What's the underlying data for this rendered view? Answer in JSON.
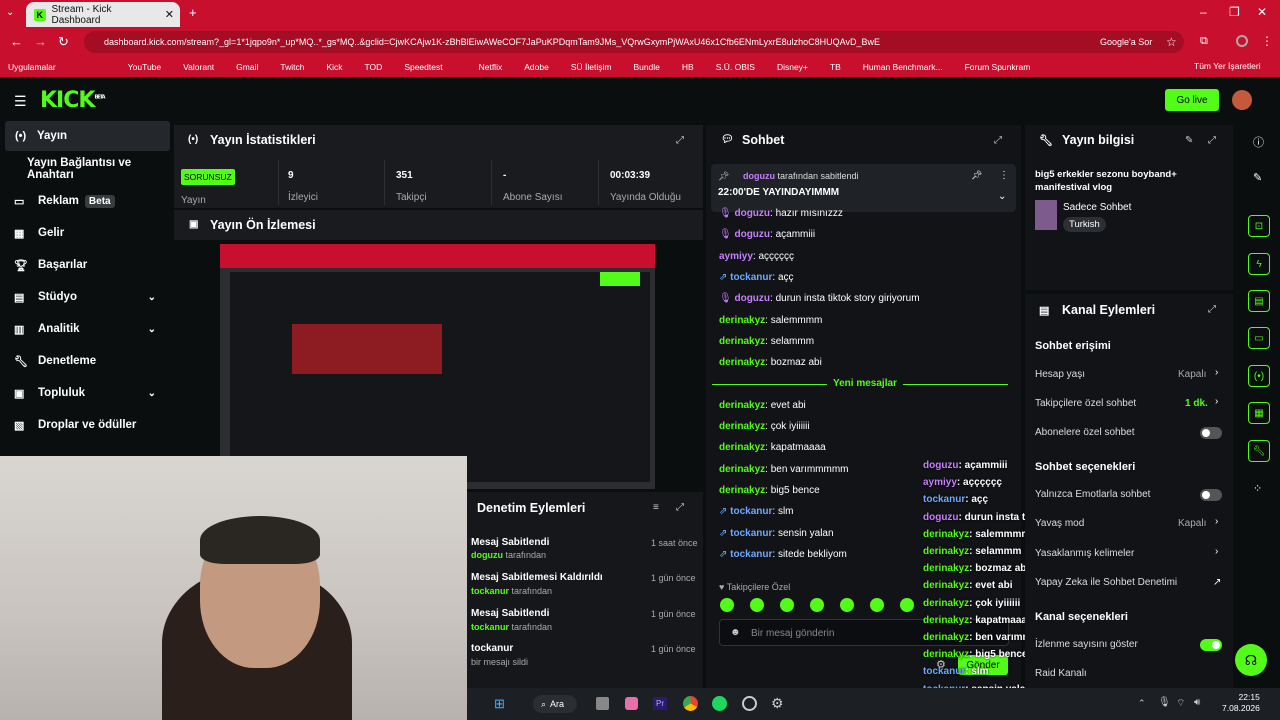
{
  "browser": {
    "tab_title": "Stream - Kick Dashboard",
    "url": "dashboard.kick.com/stream?_gl=1*1jqpo9n*_up*MQ..*_gs*MQ..&gclid=CjwKCAjw1K-zBhBlEiwAWeCOF7JaPuKPDqmTam9JMs_VQrwGxymPjWAxU46x1Cfb6ENmLyxrE8ulzhoC8HUQAvD_BwE",
    "google_label": "Google'a Sor",
    "bookmarks": [
      "Uygulamalar",
      "YouTube",
      "Valorant",
      "Gmail",
      "Twitch",
      "Kick",
      "TOD",
      "Speedtest",
      "Netflix",
      "Adobe",
      "SÜ İletişim",
      "Bundle",
      "HB",
      "S.Ü. OBIS",
      "Disney+",
      "TB",
      "Human Benchmark...",
      "Forum Spunkram"
    ],
    "all_bookmarks": "Tüm Yer İşaretleri"
  },
  "header": {
    "logo": "KICK",
    "beta": "BETA",
    "go_live": "Go live"
  },
  "sidebar": {
    "items": [
      {
        "label": "Yayın",
        "icon": "broadcast-icon"
      },
      {
        "label": "Yayın Bağlantısı ve Anahtarı"
      },
      {
        "label": "Reklam",
        "badge": "Beta"
      },
      {
        "label": "Gelir"
      },
      {
        "label": "Başarılar"
      },
      {
        "label": "Stüdyo"
      },
      {
        "label": "Analitik"
      },
      {
        "label": "Denetleme"
      },
      {
        "label": "Topluluk"
      },
      {
        "label": "Droplar ve ödüller"
      }
    ]
  },
  "stats": {
    "title": "Yayın İstatistikleri",
    "status": "SORUNSUZ",
    "status_label": "Yayın",
    "viewers": "9",
    "viewers_label": "İzleyici",
    "followers": "351",
    "followers_label": "Takipçi",
    "subs": "-",
    "subs_label": "Abone Sayısı",
    "uptime": "00:03:39",
    "uptime_label": "Yayında Olduğu"
  },
  "preview": {
    "title": "Yayın Ön İzlemesi"
  },
  "moderation": {
    "title": "Denetim Eylemleri",
    "items": [
      {
        "title": "Mesaj Sabitlendi",
        "user": "doguzu",
        "suffix": " tarafından",
        "time": "1 saat önce"
      },
      {
        "title": "Mesaj Sabitlemesi Kaldırıldı",
        "user": "tockanur",
        "suffix": " tarafından",
        "time": "1 gün önce"
      },
      {
        "title": "Mesaj Sabitlendi",
        "user": "tockanur",
        "suffix": " tarafından",
        "time": "1 gün önce"
      },
      {
        "title": "tockanur",
        "user": "",
        "suffix": "bir mesajı sildi",
        "time": "1 gün önce"
      }
    ]
  },
  "chat": {
    "title": "Sohbet",
    "pinned_by": "doguzu",
    "pinned_suffix": " tarafından sabitlendi",
    "pinned_text": "22:00'DE YAYINDAYIMMM",
    "new_messages": "Yeni mesajlar",
    "followers_only": "Takipçilere Özel",
    "placeholder": "Bir mesaj gönderin",
    "send": "Gönder",
    "messages": [
      {
        "user": "doguzu",
        "text": ": hazır mısınızzz",
        "color": "purple"
      },
      {
        "user": "doguzu",
        "text": ": açammiii",
        "color": "purple"
      },
      {
        "user": "aymiyy",
        "text": ": açççççç",
        "color": "purple2"
      },
      {
        "user": "tockanur",
        "text": ": açç",
        "color": "blue"
      },
      {
        "user": "doguzu",
        "text": ": durun insta tiktok story giriyorum",
        "color": "purple"
      },
      {
        "user": "derinakyz",
        "text": ": salemmmm",
        "color": "green"
      },
      {
        "user": "derinakyz",
        "text": ": selammm",
        "color": "green"
      },
      {
        "user": "derinakyz",
        "text": ": bozmaz abi",
        "color": "green"
      },
      {
        "user": "derinakyz",
        "text": ": evet abi",
        "color": "green"
      },
      {
        "user": "derinakyz",
        "text": ": çok iyiiiiii",
        "color": "green"
      },
      {
        "user": "derinakyz",
        "text": ": kapatmaaaa",
        "color": "green"
      },
      {
        "user": "derinakyz",
        "text": ": ben varımmmmm",
        "color": "green"
      },
      {
        "user": "derinakyz",
        "text": ": big5 bence",
        "color": "green"
      },
      {
        "user": "tockanur",
        "text": ": slm",
        "color": "blue"
      },
      {
        "user": "tockanur",
        "text": ": sensin yalan",
        "color": "blue"
      },
      {
        "user": "tockanur",
        "text": ": sitede bekliyom",
        "color": "blue"
      }
    ]
  },
  "overlay_chat": [
    {
      "user": "doguzu",
      "text": ": açammiii"
    },
    {
      "user": "aymiyy",
      "text": ": açççççç"
    },
    {
      "user": "tockanur",
      "text": ": açç"
    },
    {
      "user": "doguzu",
      "text": ": durun insta tiktok story giriyorum"
    },
    {
      "user": "derinakyz",
      "text": ": salemmmm"
    },
    {
      "user": "derinakyz",
      "text": ": selammm"
    },
    {
      "user": "derinakyz",
      "text": ": bozmaz abi"
    },
    {
      "user": "derinakyz",
      "text": ": evet abi"
    },
    {
      "user": "derinakyz",
      "text": ": çok iyiiiiii"
    },
    {
      "user": "derinakyz",
      "text": ": kapatmaaaa"
    },
    {
      "user": "derinakyz",
      "text": ": ben varımmmmm"
    },
    {
      "user": "derinakyz",
      "text": ": big5 bence"
    },
    {
      "user": "tockanur",
      "text": ": slm"
    },
    {
      "user": "tockanur",
      "text": ": sensin yalan"
    },
    {
      "user": "tockanur",
      "text": ": sitede bekliyom"
    }
  ],
  "info": {
    "title": "Yayın bilgisi",
    "stream_title": "big5 erkekler sezonu boyband+ manifestival vlog",
    "category": "Sadece Sohbet",
    "tag": "Turkish"
  },
  "channel": {
    "title": "Kanal Eylemleri",
    "chat_access": "Sohbet erişimi",
    "account_age": "Hesap yaşı",
    "account_age_val": "Kapalı",
    "followers_chat": "Takipçilere özel sohbet",
    "followers_chat_val": "1 dk.",
    "subs_chat": "Abonelere özel sohbet",
    "chat_options": "Sohbet seçenekleri",
    "emote_only": "Yalnızca Emotlarla sohbet",
    "slow_mode": "Yavaş mod",
    "slow_mode_val": "Kapalı",
    "banned_words": "Yasaklanmış kelimeler",
    "ai_mod": "Yapay Zeka ile Sohbet Denetimi",
    "channel_options": "Kanal seçenekleri",
    "show_viewers": "İzlenme sayısını göster",
    "raid": "Raid Kanalı"
  },
  "taskbar": {
    "search": "Ara",
    "time": "22:15",
    "date": "7.08.2026"
  }
}
